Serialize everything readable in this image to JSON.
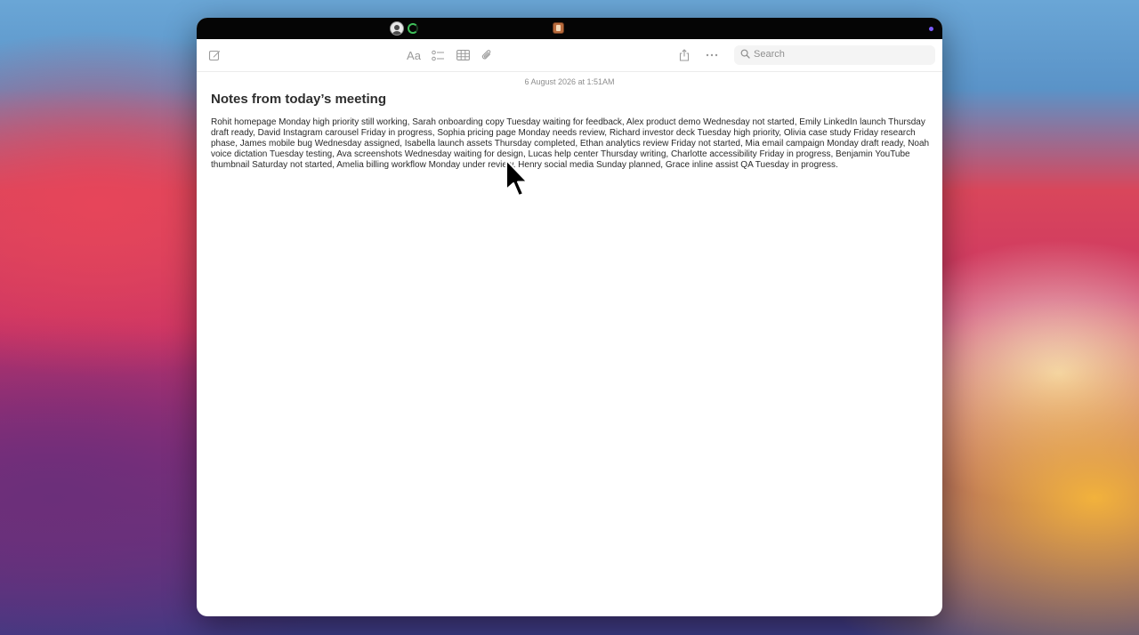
{
  "note": {
    "date": "6 August 2026 at 1:51AM",
    "title": "Notes from today’s meeting",
    "body": "Rohit homepage Monday high priority still working, Sarah onboarding copy Tuesday waiting for feedback, Alex product demo Wednesday not started, Emily LinkedIn launch Thursday draft ready, David Instagram carousel Friday in progress, Sophia pricing page Monday needs review, Richard investor deck Tuesday high priority, Olivia case study Friday research phase, James mobile bug Wednesday assigned, Isabella launch assets Thursday completed, Ethan analytics review Friday not started, Mia email campaign Monday draft ready, Noah voice dictation Tuesday testing, Ava screenshots Wednesday waiting for design, Lucas help center Thursday writing, Charlotte accessibility Friday in progress, Benjamin YouTube thumbnail Saturday not started, Amelia billing workflow Monday under review, Henry social media Sunday planned, Grace inline assist QA Tuesday in progress."
  },
  "toolbar": {
    "format_label": "Aa",
    "search_placeholder": "Search"
  },
  "icons": {
    "compose": "compose-icon",
    "format": "format-text-icon",
    "checklist": "checklist-icon",
    "table": "table-icon",
    "attachment": "paperclip-icon",
    "share": "share-icon",
    "more": "more-icon",
    "search": "search-icon"
  },
  "colors": {
    "menubar": "#050505",
    "activity_ring": "#3fc05a",
    "status_dot": "#7c5cff",
    "window_bg": "#ffffff",
    "title_text": "#2e2e2e"
  }
}
